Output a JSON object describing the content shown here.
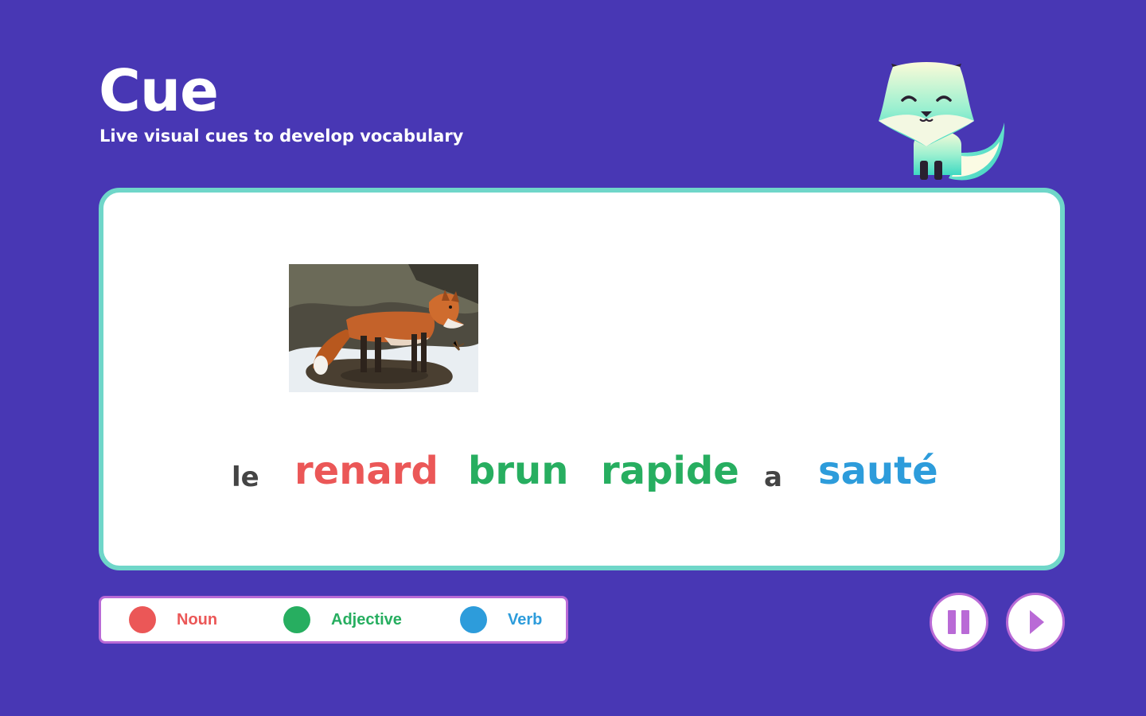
{
  "app": {
    "title": "Cue",
    "subtitle": "Live visual cues to develop vocabulary"
  },
  "mascot": {
    "icon": "fox-mascot-icon"
  },
  "cue_card": {
    "image": {
      "subject": "red fox in snow"
    },
    "sentence": [
      {
        "text": "le",
        "type": "other",
        "color": "#444444"
      },
      {
        "text": "renard",
        "type": "noun",
        "color": "#eb5757"
      },
      {
        "text": "brun",
        "type": "adjective",
        "color": "#27ae60"
      },
      {
        "text": "rapide",
        "type": "adjective",
        "color": "#27ae60"
      },
      {
        "text": "a",
        "type": "other",
        "color": "#444444"
      },
      {
        "text": "sauté",
        "type": "verb",
        "color": "#2d9cdb"
      }
    ]
  },
  "legend": {
    "items": [
      {
        "label": "Noun",
        "color": "#eb5757"
      },
      {
        "label": "Adjective",
        "color": "#27ae60"
      },
      {
        "label": "Verb",
        "color": "#2d9cdb"
      }
    ]
  },
  "controls": {
    "pause_icon": "pause-icon",
    "play_icon": "play-icon",
    "accent": "#b96ad6"
  },
  "colors": {
    "background": "#4837b4",
    "card_border": "#6fd6c9"
  }
}
